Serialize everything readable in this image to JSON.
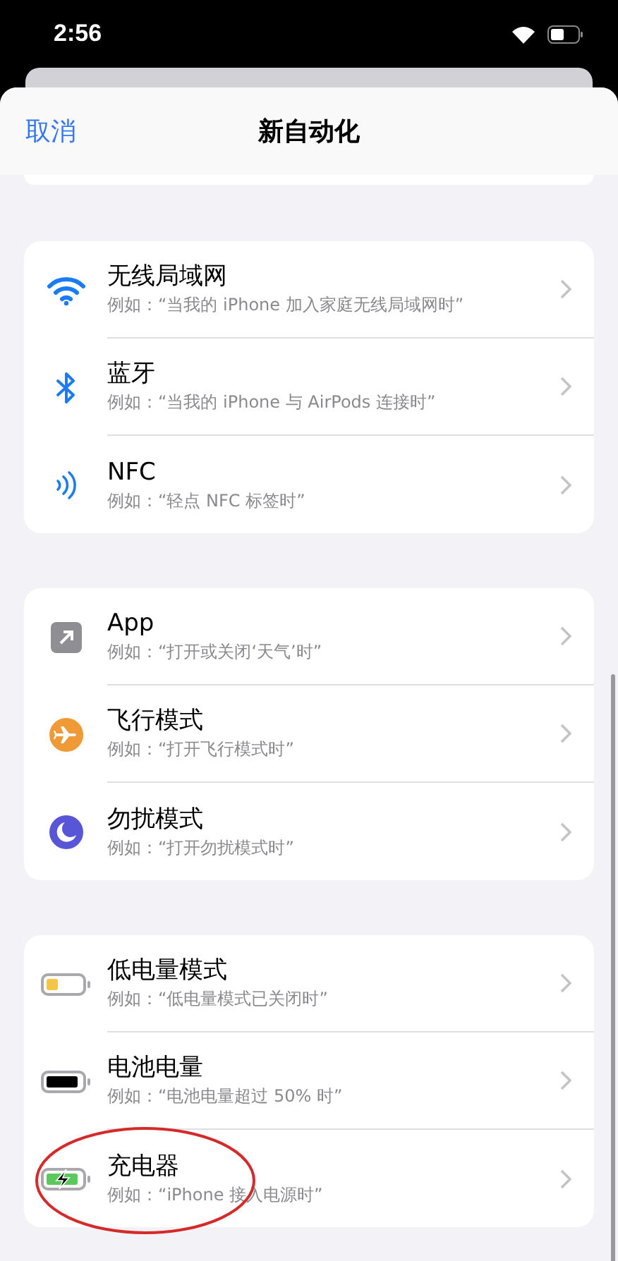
{
  "status_bar": {
    "time": "2:56"
  },
  "nav": {
    "cancel": "取消",
    "title": "新自动化"
  },
  "groups": [
    {
      "rows": [
        {
          "kind": "wifi",
          "title": "无线局域网",
          "subtitle": "例如：“当我的 iPhone 加入家庭无线局域网时”"
        },
        {
          "kind": "bluetooth",
          "title": "蓝牙",
          "subtitle": "例如：“当我的 iPhone 与 AirPods 连接时”"
        },
        {
          "kind": "nfc",
          "title": "NFC",
          "subtitle": "例如：“轻点 NFC 标签时”"
        }
      ]
    },
    {
      "rows": [
        {
          "kind": "app",
          "title": "App",
          "subtitle": "例如：“打开或关闭‘天气’时”"
        },
        {
          "kind": "airplane",
          "title": "飞行模式",
          "subtitle": "例如：“打开飞行模式时”"
        },
        {
          "kind": "moon",
          "title": "勿扰模式",
          "subtitle": "例如：“打开勿扰模式时”"
        }
      ]
    },
    {
      "rows": [
        {
          "kind": "battery-low",
          "title": "低电量模式",
          "subtitle": "例如：“低电量模式已关闭时”"
        },
        {
          "kind": "battery",
          "title": "电池电量",
          "subtitle": "例如：“电池电量超过 50% 时”"
        },
        {
          "kind": "battery-charging",
          "title": "充电器",
          "subtitle": "例如：“iPhone 接入电源时”"
        }
      ]
    }
  ]
}
